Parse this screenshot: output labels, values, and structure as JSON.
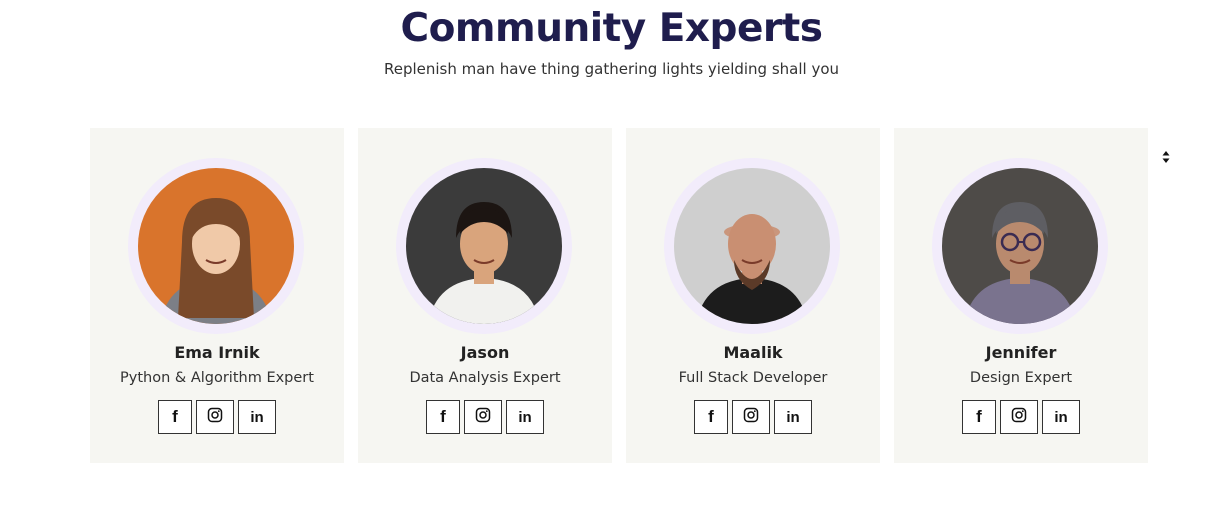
{
  "header": {
    "title": "Community Experts",
    "subtitle": "Replenish man have thing gathering lights yielding shall you"
  },
  "experts": [
    {
      "name": "Ema Irnik",
      "role": "Python & Algorithm Expert",
      "photo_bg": "#d9742c",
      "photo_skin": "#f0c9a8",
      "photo_hair": "#7a4a2a",
      "photo_cloth": "#7c7f86"
    },
    {
      "name": "Jason",
      "role": "Data Analysis Expert",
      "photo_bg": "#3b3b3b",
      "photo_skin": "#d9a47c",
      "photo_hair": "#1c1512",
      "photo_cloth": "#f1f1ee"
    },
    {
      "name": "Maalik",
      "role": "Full Stack Developer",
      "photo_bg": "#cfcfcf",
      "photo_skin": "#c98f72",
      "photo_hair": "#5b3a28",
      "photo_cloth": "#1c1c1c"
    },
    {
      "name": "Jennifer",
      "role": "Design Expert",
      "photo_bg": "#4e4b48",
      "photo_skin": "#b98a6e",
      "photo_hair": "#5e5e63",
      "photo_cloth": "#7a738e"
    }
  ],
  "socials": {
    "facebook_label": "f",
    "linkedin_label": "in",
    "icons": [
      "facebook-icon",
      "instagram-icon",
      "linkedin-icon"
    ]
  },
  "colors": {
    "title": "#1f1d4d",
    "card_bg": "#f6f6f2",
    "avatar_ring": "#f2ecfb"
  }
}
